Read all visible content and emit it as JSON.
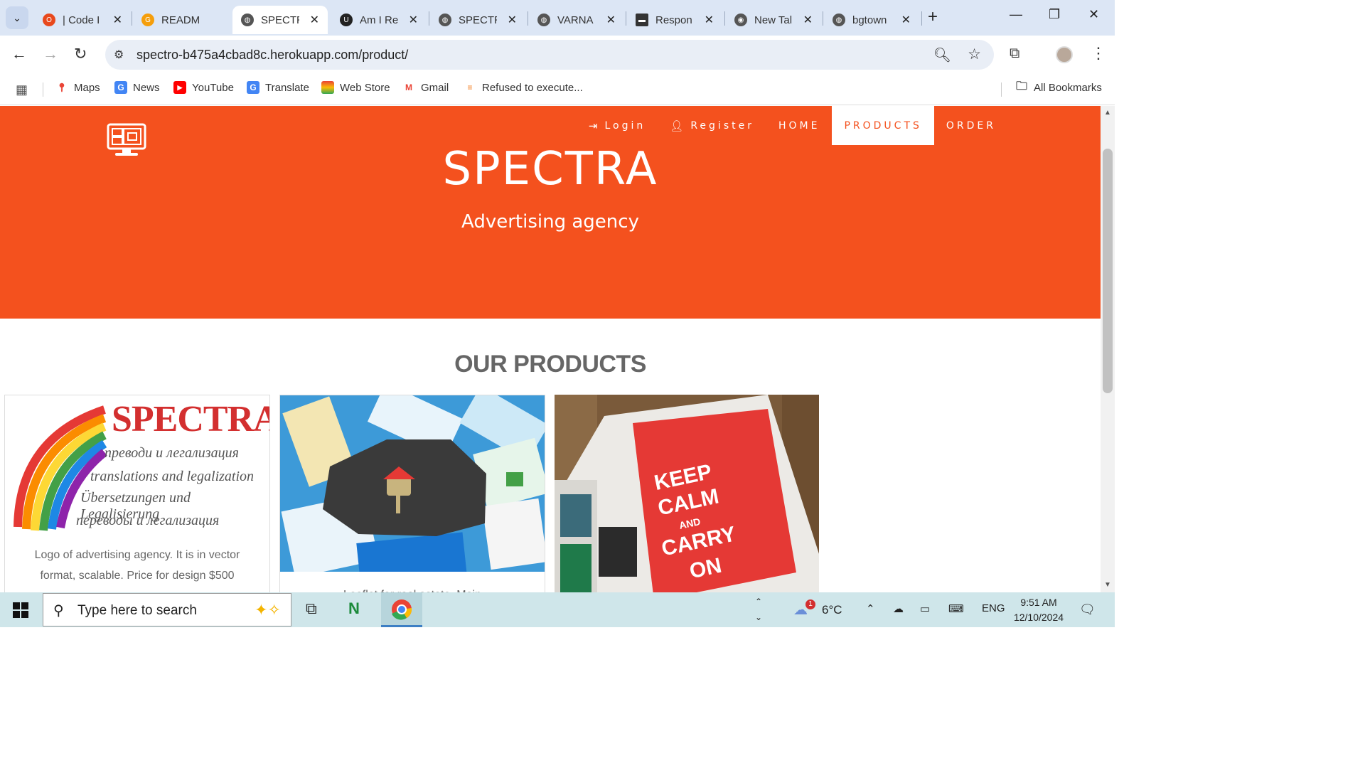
{
  "browser": {
    "tabs": [
      {
        "label": "| Code I",
        "icon": "opera-icon",
        "color": "#e8481c"
      },
      {
        "label": "READM",
        "icon": "gitpod-icon",
        "color": "#f59e0b"
      },
      {
        "label": "SPECTR",
        "icon": "globe-icon",
        "color": "#555555",
        "active": true
      },
      {
        "label": "Am I Re",
        "icon": "ui-dev-icon",
        "color": "#222222"
      },
      {
        "label": "SPECTR",
        "icon": "globe-icon",
        "color": "#555555"
      },
      {
        "label": "VARNA",
        "icon": "globe-icon",
        "color": "#555555"
      },
      {
        "label": "Respon",
        "icon": "keyboard-icon",
        "color": "#333333"
      },
      {
        "label": "New Tal",
        "icon": "chrome-icon",
        "color": "#555555"
      },
      {
        "label": "bgtown",
        "icon": "globe-icon",
        "color": "#555555"
      }
    ],
    "url": "spectro-b475a4cbad8c.herokuapp.com/product/",
    "bookmarks": [
      {
        "label": "Maps",
        "icon": "maps-icon"
      },
      {
        "label": "News",
        "icon": "news-icon"
      },
      {
        "label": "YouTube",
        "icon": "youtube-icon"
      },
      {
        "label": "Translate",
        "icon": "translate-icon"
      },
      {
        "label": "Web Store",
        "icon": "webstore-icon"
      },
      {
        "label": "Gmail",
        "icon": "gmail-icon"
      },
      {
        "label": "Refused to execute...",
        "icon": "stackoverflow-icon"
      }
    ],
    "all_bookmarks": "All Bookmarks"
  },
  "site": {
    "nav": {
      "login": "Login",
      "register": "Register",
      "home": "HOME",
      "products": "PRODUCTS",
      "order": "ORDER"
    },
    "title": "SPECTRA",
    "subtitle": "Advertising agency",
    "section_title": "OUR PRODUCTS",
    "accent": "#f4511e",
    "products": [
      {
        "image_alt": "SPECTRA logo",
        "logo_word": "SPECTRA",
        "logo_lines": [
          "преводи и легализация",
          "translations and legalization",
          "Übersetzungen und Legalisierung",
          "переводы и легализация"
        ],
        "description": "Logo of advertising agency. It is in vector format, scalable. Price for design $500"
      },
      {
        "image_alt": "Real estate leaflets with house key",
        "description": "Leaflet for real estate. Main"
      },
      {
        "image_alt": "Keep calm and carry on magazine page",
        "poster_lines": [
          "KEEP",
          "CALM",
          "AND",
          "CARRY",
          "ON"
        ],
        "description": ""
      }
    ]
  },
  "taskbar": {
    "search_placeholder": "Type here to search",
    "weather": "6°C",
    "weather_badge": "1",
    "lang": "ENG",
    "time": "9:51 AM",
    "date": "12/10/2024"
  }
}
